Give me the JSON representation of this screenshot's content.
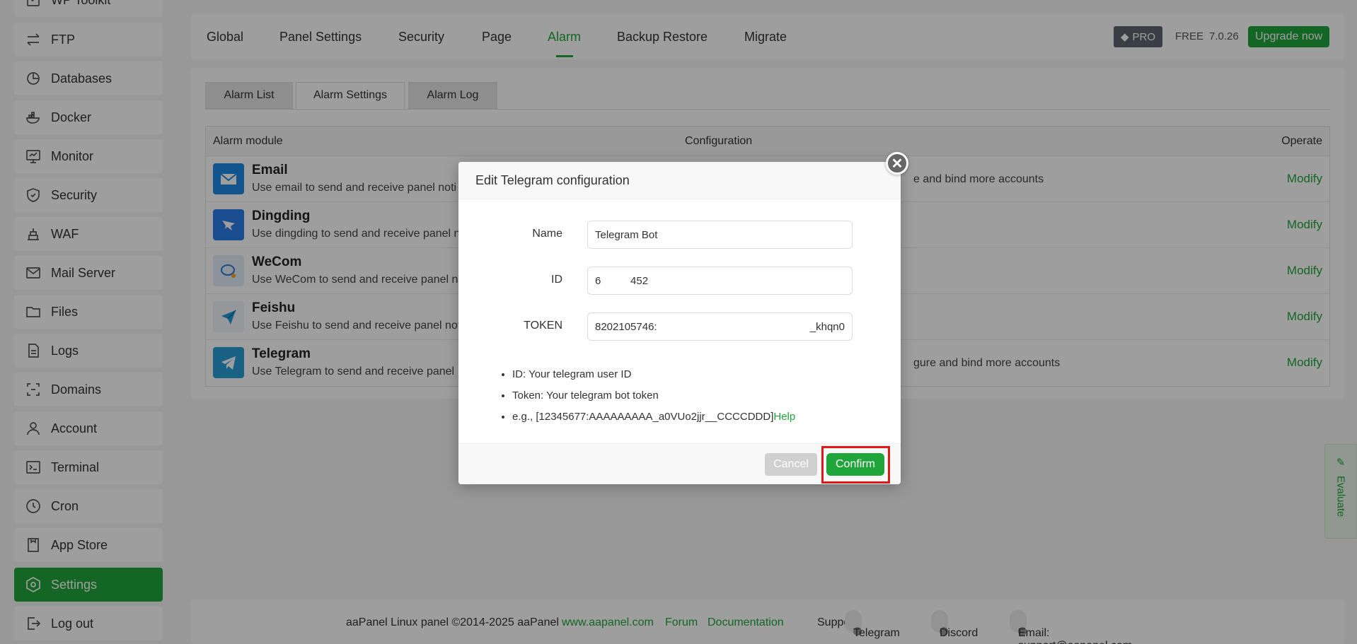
{
  "sidebar": {
    "items": [
      {
        "label": "WP Toolkit",
        "icon": "wp-toolkit-icon"
      },
      {
        "label": "FTP",
        "icon": "ftp-icon"
      },
      {
        "label": "Databases",
        "icon": "database-icon"
      },
      {
        "label": "Docker",
        "icon": "docker-icon"
      },
      {
        "label": "Monitor",
        "icon": "monitor-icon"
      },
      {
        "label": "Security",
        "icon": "shield-icon"
      },
      {
        "label": "WAF",
        "icon": "waf-icon"
      },
      {
        "label": "Mail Server",
        "icon": "mail-icon"
      },
      {
        "label": "Files",
        "icon": "folder-icon"
      },
      {
        "label": "Logs",
        "icon": "logs-icon"
      },
      {
        "label": "Domains",
        "icon": "domains-icon"
      },
      {
        "label": "Account",
        "icon": "user-icon"
      },
      {
        "label": "Terminal",
        "icon": "terminal-icon"
      },
      {
        "label": "Cron",
        "icon": "clock-icon"
      },
      {
        "label": "App Store",
        "icon": "store-icon"
      },
      {
        "label": "Settings",
        "icon": "settings-icon"
      },
      {
        "label": "Log out",
        "icon": "logout-icon"
      }
    ]
  },
  "topbar": {
    "tabs": [
      "Global",
      "Panel Settings",
      "Security",
      "Page",
      "Alarm",
      "Backup Restore",
      "Migrate"
    ],
    "active_tab": "Alarm",
    "pro_label": "PRO",
    "free_label": "FREE",
    "version": "7.0.26",
    "upgrade_label": "Upgrade now"
  },
  "subtabs": [
    "Alarm List",
    "Alarm Settings",
    "Alarm Log"
  ],
  "table": {
    "headers": [
      "Alarm module",
      "Configuration",
      "Operate"
    ],
    "rows": [
      {
        "name": "Email",
        "desc": "Use email to send and receive panel noti",
        "conf": "e and bind more accounts",
        "action": "Modify",
        "color": "#1e88e5"
      },
      {
        "name": "Dingding",
        "desc": "Use dingding to send and receive panel n",
        "conf": "",
        "action": "Modify",
        "color": "#2b7de9"
      },
      {
        "name": "WeCom",
        "desc": "Use WeCom to send and receive panel n",
        "conf": "",
        "action": "Modify",
        "color": "#e3eefa"
      },
      {
        "name": "Feishu",
        "desc": "Use Feishu to send and receive panel not",
        "conf": "",
        "action": "Modify",
        "color": "#f0f4fa"
      },
      {
        "name": "Telegram",
        "desc": "Use Telegram to send and receive panel",
        "conf": "gure and bind more accounts",
        "action": "Modify",
        "color": "#2a9fd6"
      }
    ]
  },
  "modal": {
    "title": "Edit Telegram configuration",
    "fields": {
      "name_label": "Name",
      "name_value": "Telegram Bot",
      "id_label": "ID",
      "id_value": "6          452",
      "token_label": "TOKEN",
      "token_value": "8202105746:",
      "token_tail": "_khqn0"
    },
    "notes": {
      "id_note": "ID: Your telegram user ID",
      "token_note": "Token: Your telegram bot token",
      "example": "e.g., [12345677:AAAAAAAAA_a0VUo2jjr__CCCCDDD]",
      "help": "Help"
    },
    "cancel_label": "Cancel",
    "confirm_label": "Confirm"
  },
  "footer": {
    "copyright": "aaPanel Linux panel ©2014-2025 aaPanel",
    "site": "www.aapanel.com",
    "forum": "Forum",
    "docs": "Documentation",
    "support_label": "Support:",
    "telegram": "Telegram",
    "discord": "Discord",
    "email": "Email: support@aapanel.com"
  },
  "evaluate_label": "Evaluate",
  "colors": {
    "accent": "#20a53a",
    "highlight": "#e01818"
  }
}
